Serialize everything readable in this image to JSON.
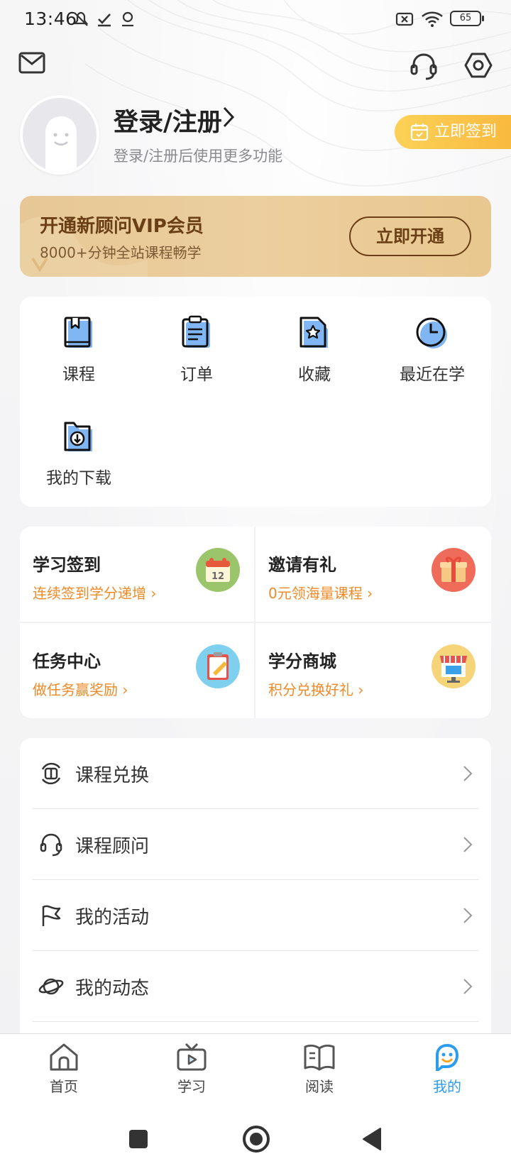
{
  "status_bar": {
    "time": "13:46",
    "battery": "65"
  },
  "header": {
    "mail_icon": "mail-icon",
    "service_icon": "headset-icon",
    "settings_icon": "settings-hex-icon"
  },
  "profile": {
    "title": "登录/注册",
    "subtitle": "登录/注册后使用更多功能",
    "checkin_label": "立即签到"
  },
  "vip": {
    "title": "开通新顾问VIP会员",
    "subtitle": "8000+分钟全站课程畅学",
    "button": "立即开通"
  },
  "quick_items": [
    {
      "label": "课程",
      "icon": "course-book-icon"
    },
    {
      "label": "订单",
      "icon": "order-clipboard-icon"
    },
    {
      "label": "收藏",
      "icon": "favorite-star-icon"
    },
    {
      "label": "最近在学",
      "icon": "recent-clock-icon"
    },
    {
      "label": "我的下载",
      "icon": "download-folder-icon"
    }
  ],
  "tasks": [
    {
      "title": "学习签到",
      "subtitle": "连续签到学分递增",
      "icon": "calendar-icon"
    },
    {
      "title": "邀请有礼",
      "subtitle": "0元领海量课程",
      "icon": "gift-icon"
    },
    {
      "title": "任务中心",
      "subtitle": "做任务赢奖励",
      "icon": "task-clipboard-icon"
    },
    {
      "title": "学分商城",
      "subtitle": "积分兑换好礼",
      "icon": "shop-icon"
    }
  ],
  "menu": [
    {
      "label": "课程兑换",
      "icon": "exchange-icon"
    },
    {
      "label": "课程顾问",
      "icon": "headset-icon"
    },
    {
      "label": "我的活动",
      "icon": "flag-icon"
    },
    {
      "label": "我的动态",
      "icon": "planet-icon"
    }
  ],
  "tabs": [
    {
      "label": "首页",
      "icon": "home-icon"
    },
    {
      "label": "学习",
      "icon": "tv-icon"
    },
    {
      "label": "阅读",
      "icon": "book-open-icon"
    },
    {
      "label": "我的",
      "icon": "smiley-icon",
      "active": true
    }
  ],
  "colors": {
    "accent_blue": "#2c9cf0",
    "accent_orange": "#f08a27",
    "vip_brown": "#6a3f15",
    "checkin_yellow": "#f8b83d"
  }
}
